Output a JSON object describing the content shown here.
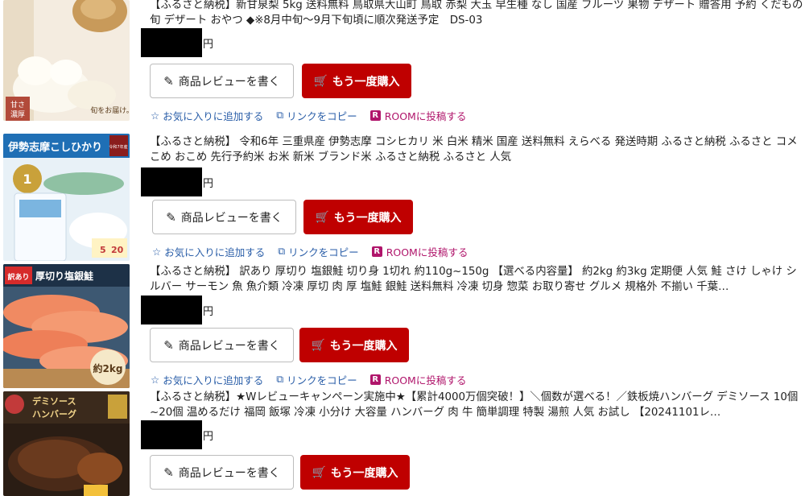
{
  "items": [
    {
      "title": "【ふるさと納税】新甘泉梨 5kg 送料無料 鳥取県大山町 鳥取 赤梨 大玉 早生種 なし 国産 フルーツ 果物 デザート 贈答用 予約 くだもの 旬 デザート おやつ ◆※8月中旬～9月下旬頃に順次発送予定　DS-03",
      "yen": "円",
      "review_label": "商品レビューを書く",
      "buy_label": "もう一度購入",
      "favorite_label": "お気に入りに追加する",
      "copy_label": "リンクをコピー",
      "room_label": "ROOMに投稿する",
      "thumb_text": [
        "甘さ",
        "濃厚",
        "旬をお届け。"
      ]
    },
    {
      "title": "【ふるさと納税】 令和6年 三重県産 伊勢志摩 コシヒカリ 米 白米 精米 国産 送料無料 えらべる 発送時期 ふるさと納税 ふるさと コメ こめ おこめ 先行予約米 お米 新米 ブランド米 ふるさと納税 ふるさと 人気",
      "yen": "円",
      "review_label": "商品レビューを書く",
      "buy_label": "もう一度購入",
      "favorite_label": "お気に入りに追加する",
      "copy_label": "リンクをコピー",
      "room_label": "ROOMに投稿する",
      "thumb_text": [
        "伊勢志摩こしひかり",
        "令和7年産",
        "5",
        "20"
      ]
    },
    {
      "title": "【ふるさと納税】 訳あり 厚切り 塩銀鮭 切り身 1切れ 約110g~150g 【選べる内容量】 約2kg 約3kg 定期便 人気 鮭 さけ しゃけ シルバー サーモン 魚 魚介類 冷凍 厚切 肉 厚 塩鮭 銀鮭 送料無料 冷凍 切身 惣菜 お取り寄せ グルメ 規格外 不揃い 千葉…",
      "yen": "円",
      "review_label": "商品レビューを書く",
      "buy_label": "もう一度購入",
      "favorite_label": "お気に入りに追加する",
      "copy_label": "リンクをコピー",
      "room_label": "ROOMに投稿する",
      "thumb_text": [
        "訳あり",
        "厚切り塩銀鮭",
        "約2kg"
      ]
    },
    {
      "title": "【ふるさと納税】★Wレビューキャンペーン実施中★【累計4000万個突破！】＼個数が選べる！／鉄板焼ハンバーグ デミソース 10個~20個 温めるだけ 福岡 飯塚 冷凍 小分け 大容量 ハンバーグ 肉 牛 簡単調理 特製 湯煎 人気 お試し 【20241101レ…",
      "yen": "円",
      "review_label": "商品レビューを書く",
      "buy_label": "もう一度購入",
      "thumb_text": [
        "デミソース",
        "ハンバーグ"
      ]
    }
  ],
  "colors": {
    "buy": "#bf0000",
    "link": "#2a5ea8",
    "room": "#b0156b"
  },
  "icons": {
    "review": "pencil-icon",
    "buy": "cart-icon",
    "favorite": "star-icon",
    "copy": "copy-icon",
    "room": "room-icon"
  }
}
